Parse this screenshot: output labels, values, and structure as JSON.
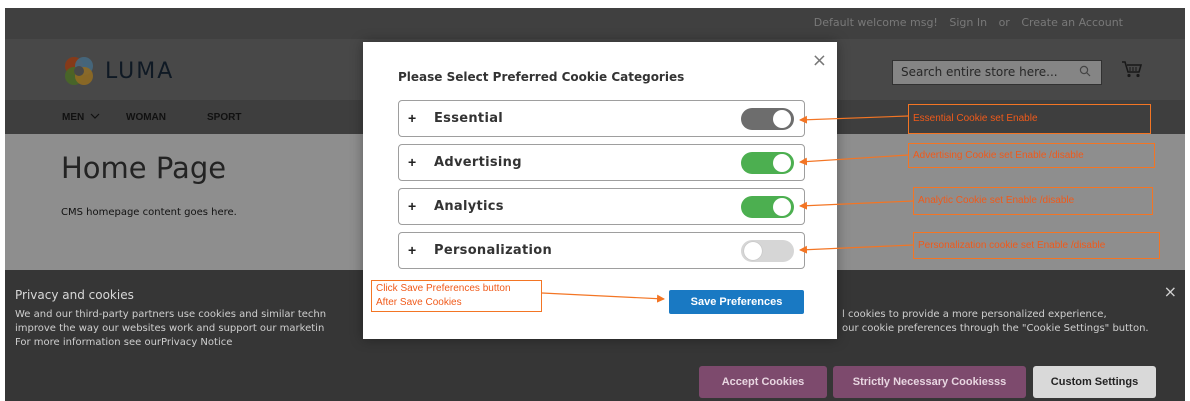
{
  "topbar": {
    "welcome": "Default welcome msg!",
    "sign_in": "Sign In",
    "or": "or",
    "create_account": "Create an Account"
  },
  "header": {
    "logo": "LUMA",
    "search_placeholder": "Search entire store here..."
  },
  "nav": [
    {
      "label": "MEN"
    },
    {
      "label": "WOMAN"
    },
    {
      "label": "SPORT"
    }
  ],
  "main": {
    "title": "Home Page",
    "content": "CMS homepage content goes here."
  },
  "cookie_bar": {
    "title": "Privacy and cookies",
    "text": "We and our third-party partners use cookies and similar techn                                                                                                                 l cookies to provide a more personalized experience, improve the way our websites work and support our marketin                                                                                                        our cookie preferences through the \"Cookie Settings\" button. For more information see ourPrivacy Notice",
    "text_line1_left": "We and our third-party partners use cookies and similar techn",
    "text_line1_right": "l cookies to provide a more personalized experience,",
    "text_line2_left": "improve the way our websites work and support our marketin",
    "text_line2_right": "our cookie preferences through the \"Cookie Settings\" button.",
    "text_line3": "For more information see ourPrivacy Notice",
    "close": "×",
    "accept": "Accept Cookies",
    "strict": "Strictly Necessary Cookiesss",
    "custom": "Custom Settings"
  },
  "modal": {
    "title": "Please Select Preferred Cookie Categories",
    "close": "×",
    "categories": [
      {
        "plus": "+",
        "label": "Essential",
        "state": "on-locked",
        "color": "#6d6d6d"
      },
      {
        "plus": "+",
        "label": "Advertising",
        "state": "on",
        "color": "#4caf50"
      },
      {
        "plus": "+",
        "label": "Analytics",
        "state": "on",
        "color": "#4caf50"
      },
      {
        "plus": "+",
        "label": "Personalization",
        "state": "off",
        "color": "#d6d6d6"
      }
    ],
    "save_label": "Save Preferences"
  },
  "annotations": {
    "essential": "Essential Cookie set Enable",
    "advertising": "Advertising Cookie set Enable /disable",
    "analytics": "Analytic Cookie set Enable /disable",
    "personalization": "Personalization cookie set  Enable /disable",
    "save_line1": "Click Save Preferences button",
    "save_line2": "After Save Cookies"
  },
  "colors": {
    "annotation": "#f37524",
    "primary": "#1979c3",
    "toggle_on": "#4caf50"
  }
}
